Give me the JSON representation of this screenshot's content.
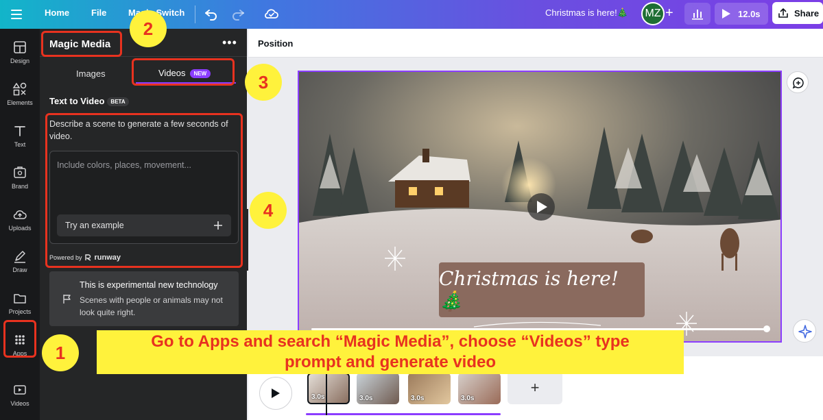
{
  "topbar": {
    "home": "Home",
    "file": "File",
    "magic_switch": "Magic Switch",
    "doc_title": "Christmas is here!🎄",
    "avatar": "MZ",
    "play_time": "12.0s",
    "share": "Share"
  },
  "rail": {
    "items": [
      {
        "label": "Design"
      },
      {
        "label": "Elements"
      },
      {
        "label": "Text"
      },
      {
        "label": "Brand"
      },
      {
        "label": "Uploads"
      },
      {
        "label": "Draw"
      },
      {
        "label": "Projects"
      },
      {
        "label": "Apps"
      },
      {
        "label": "Videos"
      }
    ]
  },
  "panel": {
    "title": "Magic Media",
    "tabs": [
      {
        "label": "Images"
      },
      {
        "label": "Videos"
      }
    ],
    "new_badge": "NEW",
    "section_title": "Text to Video",
    "beta_badge": "BETA",
    "description": "Describe a scene to generate a few seconds of video.",
    "prompt_placeholder": "Include colors, places, movement...",
    "try_example": "Try an example",
    "powered_by": "Powered by",
    "powered_brand": "runway",
    "warning_title": "This is experimental new technology",
    "warning_text": "Scenes with people or animals may not look quite right."
  },
  "canvas": {
    "context_label": "Position",
    "overlay_text": "Christmas is here! 🎄"
  },
  "timeline": {
    "clips": [
      {
        "duration": "3.0s"
      },
      {
        "duration": "3.0s"
      },
      {
        "duration": "3.0s"
      },
      {
        "duration": "3.0s"
      }
    ]
  },
  "annotations": {
    "step1": "1",
    "step2": "2",
    "step3": "3",
    "step4": "4",
    "banner_line1": "Go to Apps and search “Magic Media”, choose “Videos” type",
    "banner_line2": "prompt and generate video"
  },
  "colors": {
    "accent": "#8b3dff",
    "annotation_red": "#e8321f",
    "annotation_yellow": "#fff23c"
  }
}
